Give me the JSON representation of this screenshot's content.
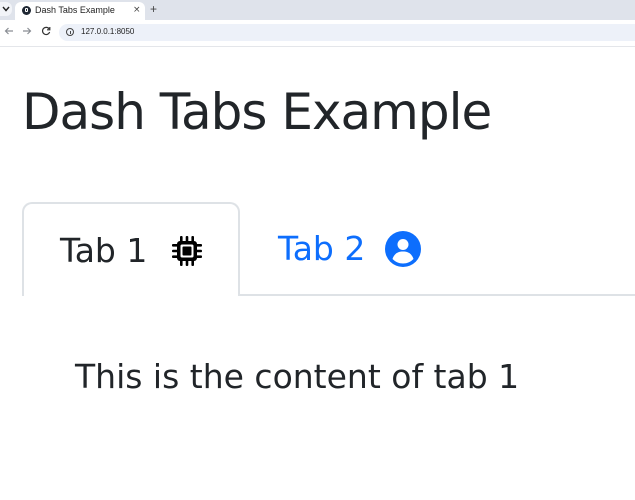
{
  "browser": {
    "tab_title": "Dash Tabs Example",
    "tab_close": "×",
    "new_tab": "+",
    "url": "127.0.0.1:8050",
    "menu_icon": "chevron-down-icon"
  },
  "page": {
    "title": "Dash Tabs Example",
    "tabs": [
      {
        "label": "Tab 1",
        "icon": "cpu-chip-icon",
        "active": true
      },
      {
        "label": "Tab 2",
        "icon": "person-circle-icon",
        "active": false
      }
    ],
    "content": "This is the content of tab 1"
  },
  "colors": {
    "active_tab_text": "#212529",
    "inactive_tab_text": "#0d6efd",
    "border": "#dee2e6",
    "title_text": "#212529"
  }
}
